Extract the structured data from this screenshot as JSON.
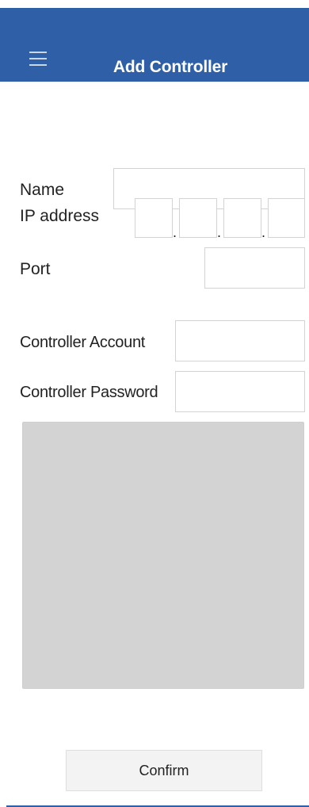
{
  "header": {
    "title": "Add Controller",
    "menu_icon": "hamburger-menu-icon",
    "background_color": "#2f5fa6"
  },
  "form": {
    "name": {
      "label": "Name",
      "value": ""
    },
    "ip_address": {
      "label": "IP address",
      "segments": [
        "",
        "",
        "",
        ""
      ],
      "separator": "."
    },
    "port": {
      "label": "Port",
      "value": ""
    },
    "controller_account": {
      "label": "Controller Account",
      "value": ""
    },
    "controller_password": {
      "label": "Controller Password",
      "value": ""
    }
  },
  "info_panel": {
    "color": "#d3d3d3"
  },
  "confirm_button": {
    "label": "Confirm"
  }
}
